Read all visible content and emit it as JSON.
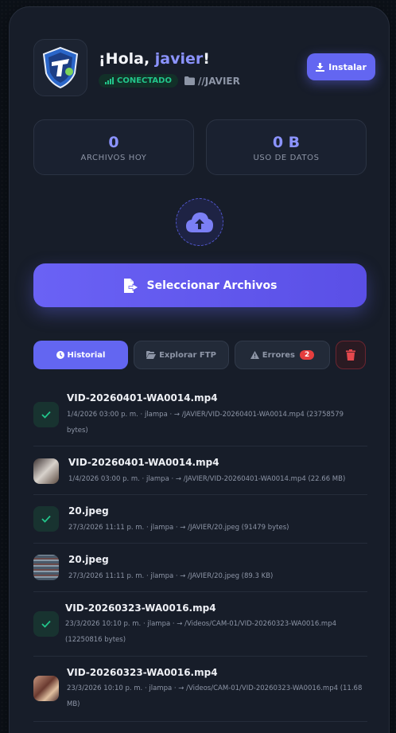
{
  "header": {
    "greeting_prefix": "¡Hola, ",
    "user_name": "javier",
    "greeting_suffix": "!",
    "status": "CONECTADO",
    "path": "//JAVIER",
    "install_label": "Instalar"
  },
  "stats": [
    {
      "value": "0",
      "label": "ARCHIVOS HOY"
    },
    {
      "value": "0 B",
      "label": "USO DE DATOS"
    }
  ],
  "select_button_label": "Seleccionar Archivos",
  "tabs": {
    "history": "Historial",
    "ftp": "Explorar FTP",
    "errors": "Errores",
    "errors_count": "2"
  },
  "colors": {
    "accent": "#6366f1",
    "success": "#22c58a",
    "danger": "#e53e3e",
    "background": "#171d29"
  },
  "history": [
    {
      "name": "VID-20260401-WA0014.mp4",
      "meta": "1/4/2026 03:00 p. m. · jlampa · → /JAVIER/VID-20260401-WA0014.mp4 (23758579 bytes)",
      "icon": "check-icon"
    },
    {
      "name": "VID-20260401-WA0014.mp4",
      "meta": "1/4/2026 03:00 p. m. · jlampa · → /JAVIER/VID-20260401-WA0014.mp4 (22.66 MB)",
      "icon": "video-thumbnail"
    },
    {
      "name": "20.jpeg",
      "meta": "27/3/2026 11:11 p. m. · jlampa · → /JAVIER/20.jpeg (91479 bytes)",
      "icon": "check-icon"
    },
    {
      "name": "20.jpeg",
      "meta": "27/3/2026 11:11 p. m. · jlampa · → /JAVIER/20.jpeg (89.3 KB)",
      "icon": "image-thumbnail"
    },
    {
      "name": "VID-20260323-WA0016.mp4",
      "meta": "23/3/2026 10:10 p. m. · jlampa · → /Videos/CAM-01/VID-20260323-WA0016.mp4 (12250816 bytes)",
      "icon": "check-icon"
    },
    {
      "name": "VID-20260323-WA0016.mp4",
      "meta": "23/3/2026 10:10 p. m. · jlampa · → /Videos/CAM-01/VID-20260323-WA0016.mp4 (11.68 MB)",
      "icon": "video-thumbnail"
    }
  ]
}
